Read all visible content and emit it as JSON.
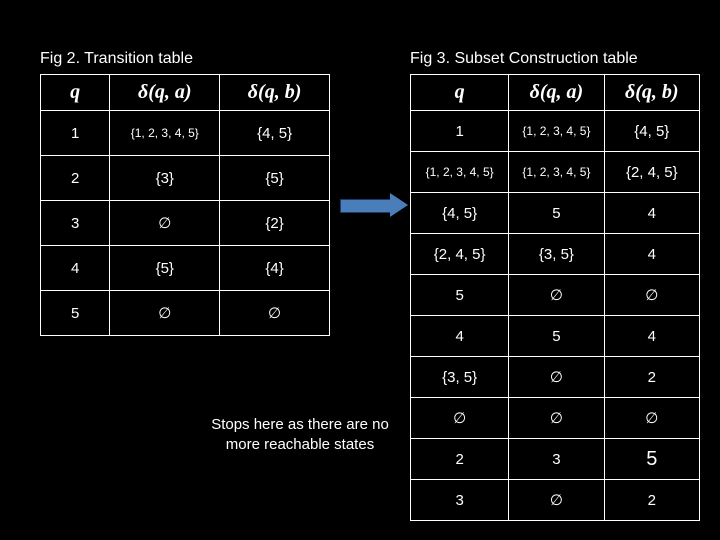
{
  "left": {
    "caption": "Fig 2. Transition table",
    "headers": [
      "q",
      "δ(q, a)",
      "δ(q, b)"
    ],
    "rows": [
      [
        "1",
        "{1, 2, 3, 4, 5}",
        "{4, 5}"
      ],
      [
        "2",
        "{3}",
        "{5}"
      ],
      [
        "3",
        "∅",
        "{2}"
      ],
      [
        "4",
        "{5}",
        "{4}"
      ],
      [
        "5",
        "∅",
        "∅"
      ]
    ]
  },
  "right": {
    "caption": "Fig 3. Subset Construction table",
    "headers": [
      "q",
      "δ(q, a)",
      "δ(q, b)"
    ],
    "rows": [
      [
        "1",
        "{1, 2, 3, 4, 5}",
        "{4, 5}"
      ],
      [
        "{1, 2, 3, 4, 5}",
        "{1, 2, 3, 4, 5}",
        "{2, 4, 5}"
      ],
      [
        "{4, 5}",
        "5",
        "4"
      ],
      [
        "{2, 4, 5}",
        "{3, 5}",
        "4"
      ],
      [
        "5",
        "∅",
        "∅"
      ],
      [
        "4",
        "5",
        "4"
      ],
      [
        "{3, 5}",
        "∅",
        "2"
      ],
      [
        "∅",
        "∅",
        "∅"
      ],
      [
        "2",
        "3",
        "5"
      ],
      [
        "3",
        "∅",
        "2"
      ]
    ]
  },
  "note": "Stops here as there are no more reachable states"
}
